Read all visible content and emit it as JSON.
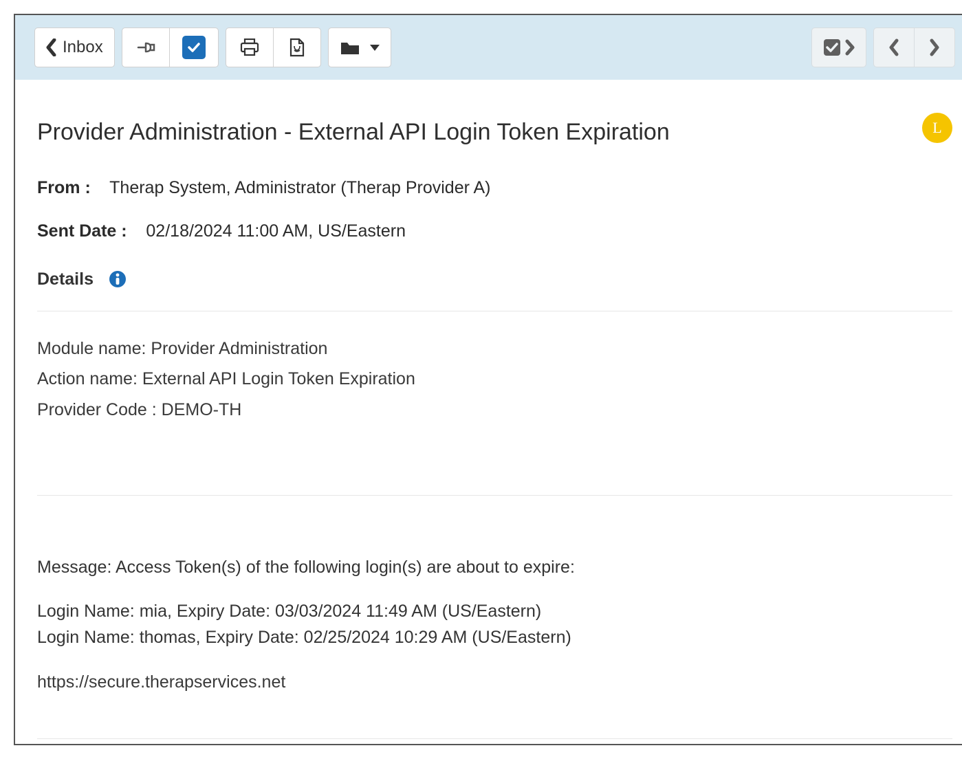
{
  "toolbar": {
    "inbox_label": "Inbox",
    "avatar_letter": "L"
  },
  "message": {
    "title": "Provider Administration - External API Login Token Expiration",
    "from_label": "From :",
    "from_value": "Therap System, Administrator (Therap Provider A)",
    "sent_label": "Sent Date :",
    "sent_value": "02/18/2024 11:00 AM, US/Eastern",
    "details_label": "Details"
  },
  "details": {
    "module_line": "Module name: Provider Administration",
    "action_line": "Action name: External API Login Token Expiration",
    "provider_line": "Provider Code : DEMO-TH"
  },
  "body": {
    "intro": "Message: Access Token(s) of the following login(s) are about to expire:",
    "login1": "Login Name: mia, Expiry Date: 03/03/2024 11:49 AM (US/Eastern)",
    "login2": "Login Name: thomas, Expiry Date: 02/25/2024 10:29 AM (US/Eastern)",
    "url": "https://secure.therapservices.net"
  }
}
